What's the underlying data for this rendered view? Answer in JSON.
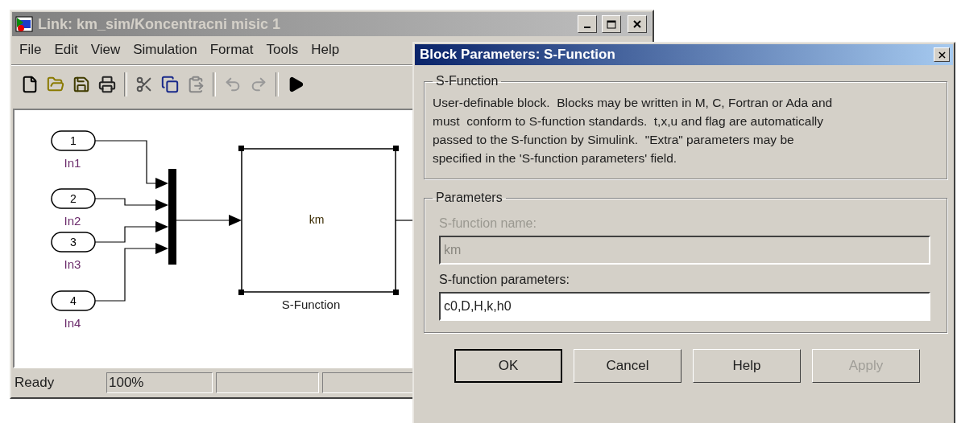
{
  "main_window": {
    "title": "Link: km_sim/Koncentracni misic 1",
    "active": false,
    "menu": [
      "File",
      "Edit",
      "View",
      "Simulation",
      "Format",
      "Tools",
      "Help"
    ],
    "diagram": {
      "inports": [
        {
          "number": "1",
          "label": "In1"
        },
        {
          "number": "2",
          "label": "In2"
        },
        {
          "number": "3",
          "label": "In3"
        },
        {
          "number": "4",
          "label": "In4"
        }
      ],
      "block": {
        "text": "km",
        "label": "S-Function"
      }
    },
    "status_bar": {
      "status": "Ready",
      "zoom": "100%"
    }
  },
  "dialog": {
    "title": "Block Parameters: S-Function",
    "description_group": {
      "title": "S-Function",
      "text": "User-definable block.  Blocks may be written in M, C, Fortran or Ada and\nmust  conform to S-function standards.  t,x,u and flag are automatically\npassed to the S-function by Simulink.  \"Extra\" parameters may be\nspecified in the 'S-function parameters' field."
    },
    "parameters_group": {
      "title": "Parameters",
      "fields": [
        {
          "label": "S-function name:",
          "value": "km",
          "disabled": true
        },
        {
          "label": "S-function parameters:",
          "value": "c0,D,H,k,h0",
          "disabled": false
        }
      ]
    },
    "buttons": [
      {
        "label": "OK",
        "default": true,
        "disabled": false
      },
      {
        "label": "Cancel",
        "default": false,
        "disabled": false
      },
      {
        "label": "Help",
        "default": false,
        "disabled": false
      },
      {
        "label": "Apply",
        "default": false,
        "disabled": true
      }
    ]
  }
}
